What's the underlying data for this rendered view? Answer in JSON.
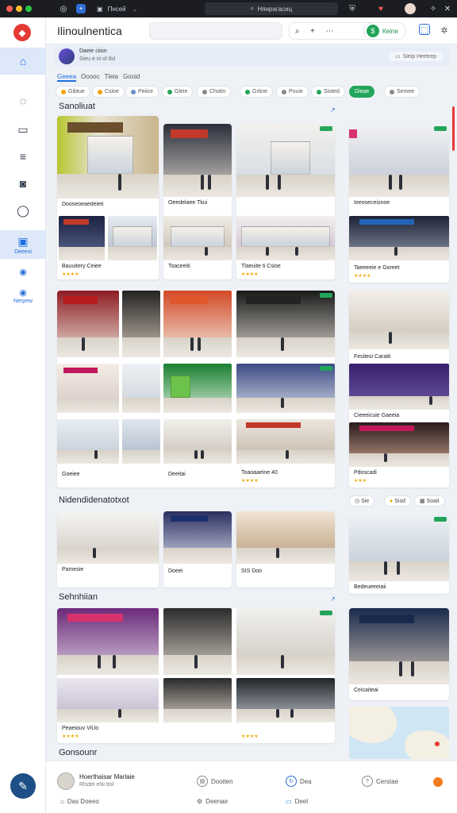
{
  "os": {
    "tab1": "Пнсей",
    "url": "Нянрагасиц",
    "window_controls": [
      "close",
      "minimize",
      "maximize"
    ]
  },
  "header": {
    "title": "Ilinoulnentica",
    "action_button": "Кеinи",
    "tools": [
      "search",
      "add",
      "more"
    ]
  },
  "rail": {
    "items": [
      {
        "icon": "home-icon"
      },
      {
        "icon": "bell-icon"
      },
      {
        "icon": "box-icon"
      },
      {
        "icon": "menu-icon"
      },
      {
        "icon": "camera-icon"
      },
      {
        "icon": "chat-icon"
      },
      {
        "icon": "store-icon",
        "label": "Deeesi"
      },
      {
        "icon": "location-icon"
      },
      {
        "icon": "globe-icon",
        "label": "Nerpew"
      }
    ]
  },
  "user": {
    "name": "Daeie ciion",
    "meta": "Sieu e ni ol tlsl",
    "right": "Sieip Heetrep"
  },
  "tabs": [
    "Geeea",
    "Ooooc",
    "Tleia",
    "Gooid"
  ],
  "filters": [
    {
      "label": "Gibtue",
      "color": "#f0a500"
    },
    {
      "label": "Csioe",
      "color": "#f0a500"
    },
    {
      "label": "Peiice",
      "color": "#6b8fc7"
    },
    {
      "label": "Gleie",
      "color": "#22a55b"
    },
    {
      "label": "Chotin",
      "color": "#888888"
    },
    {
      "label": "Grtine",
      "color": "#22a55b"
    },
    {
      "label": "Pouie",
      "color": "#888888"
    },
    {
      "label": "Sioted",
      "color": "#22a55b"
    },
    {
      "label": "Dieae",
      "color": "#888888"
    },
    {
      "label": "Semee",
      "color": "#888888"
    }
  ],
  "sections": {
    "s1": "Sanoliuat",
    "s2": "Nidendidenatotxot",
    "s3": "Sehnhiian",
    "s4": "Gonsounr"
  },
  "captions": {
    "r1a": "Dooseoeaedeieti",
    "r1b": "Oeedelaee Tkui",
    "r1c": "Ieeoseceisnoe",
    "r2a": "Bauuitery Ceiee",
    "r2b": "Toaceeiti",
    "r2c": "Tlaeuite ti Csise",
    "r2d": "Taeeeeie e Goreet",
    "r3a": "Fesitesi Caraiti",
    "r3b": "Cieeeicuie Gaeeia",
    "r4a": "Goeiee",
    "r4b": "Deeitai",
    "r4c": "Toaoaaeine 40",
    "r4d": "Pdoscadi",
    "r5a": "Pamesie",
    "r5b": "Doeei",
    "r5c": "SIS Doo",
    "r5d": "Bedeueeeiaii",
    "r6a": "Peaeiouv ViUo",
    "r6b": "Ceicaiteai"
  },
  "side_pills": [
    "Sie",
    "Sisd",
    "Soait"
  ],
  "bottom": {
    "account_name": "Hoerthaisar Marlaie",
    "account_meta": "Rlsdei eNi ttol",
    "items": [
      "Dooiten",
      "Dea",
      "Cerstae"
    ],
    "items2": [
      "Das Doeeo",
      "Deenae",
      "Deel"
    ]
  },
  "colors": {
    "accent": "#1f6fe0",
    "green": "#22a55b",
    "brand_red": "#e53935"
  }
}
